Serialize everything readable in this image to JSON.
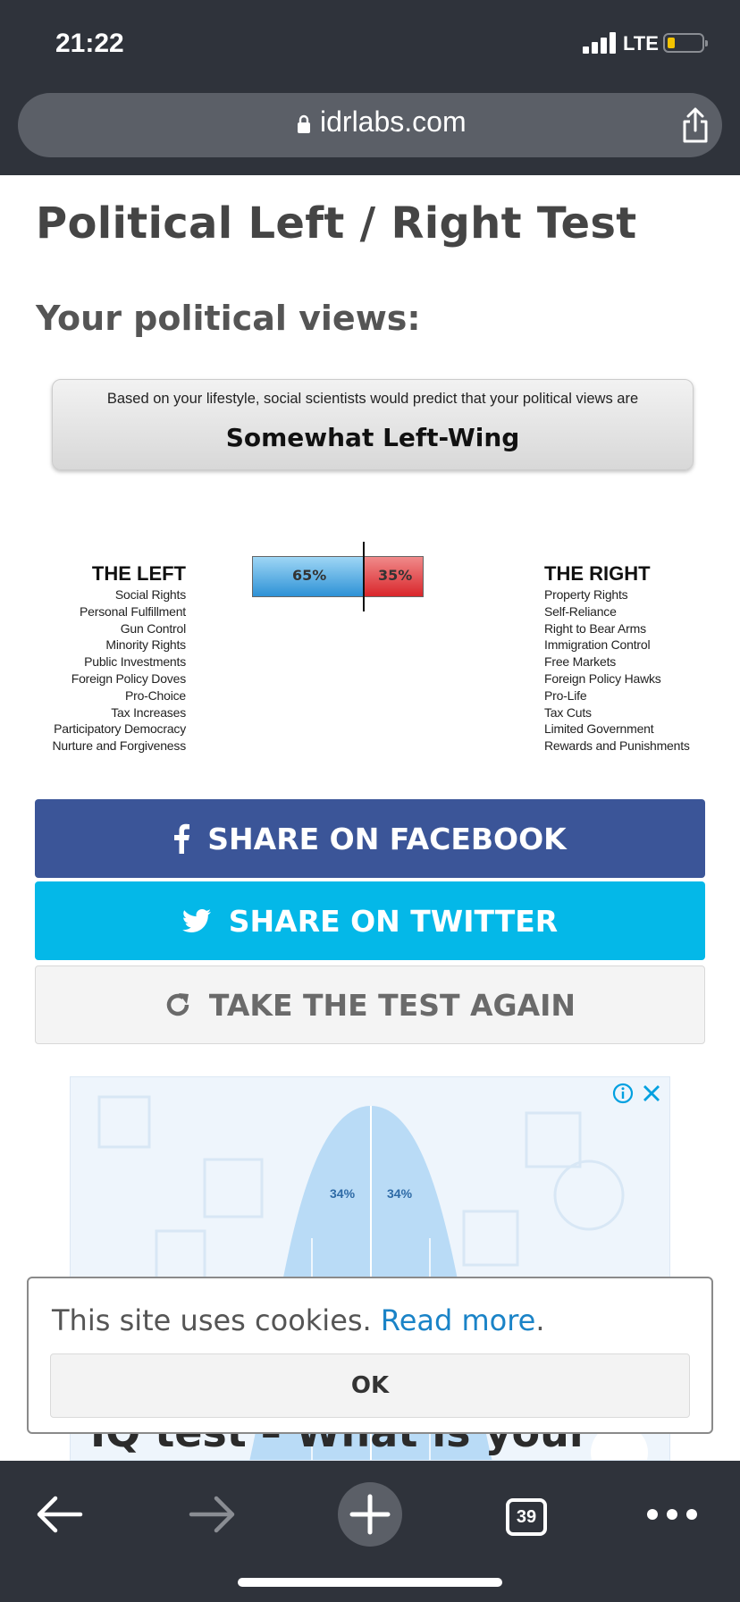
{
  "status_bar": {
    "time": "21:22",
    "network": "LTE",
    "battery_color": "#f3c300"
  },
  "browser": {
    "url": "idrlabs.com",
    "tab_count": "39"
  },
  "page": {
    "title": "Political Left / Right Test",
    "subtitle": "Your political views:",
    "result": {
      "line": "Based on your lifestyle, social scientists would predict that your political views are",
      "value": "Somewhat Left-Wing"
    },
    "score": {
      "left_label": "65%",
      "right_label": "35%",
      "left_fraction": 0.65,
      "right_fraction": 0.35,
      "left_color": "#2e92d6",
      "right_color": "#d9262b"
    },
    "left": {
      "heading": "THE LEFT",
      "items": [
        "Social Rights",
        "Personal Fulfillment",
        "Gun Control",
        "Minority Rights",
        "Public Investments",
        "Foreign Policy Doves",
        "Pro-Choice",
        "Tax Increases",
        "Participatory Democracy",
        "Nurture and Forgiveness"
      ]
    },
    "right": {
      "heading": "THE RIGHT",
      "items": [
        "Property Rights",
        "Self-Reliance",
        "Right to Bear Arms",
        "Immigration Control",
        "Free Markets",
        "Foreign Policy Hawks",
        "Pro-Life",
        "Tax Cuts",
        "Limited Government",
        "Rewards and Punishments"
      ]
    },
    "buttons": {
      "facebook": "SHARE ON FACEBOOK",
      "twitter": "SHARE ON TWITTER",
      "again": "TAKE THE TEST AGAIN"
    },
    "ad": {
      "pct_left": "34%",
      "pct_right": "34%",
      "heading": "IQ test – What is your"
    },
    "cookie": {
      "text": "This site uses cookies.",
      "link": "Read more",
      "after": ".",
      "ok": "OK"
    }
  }
}
